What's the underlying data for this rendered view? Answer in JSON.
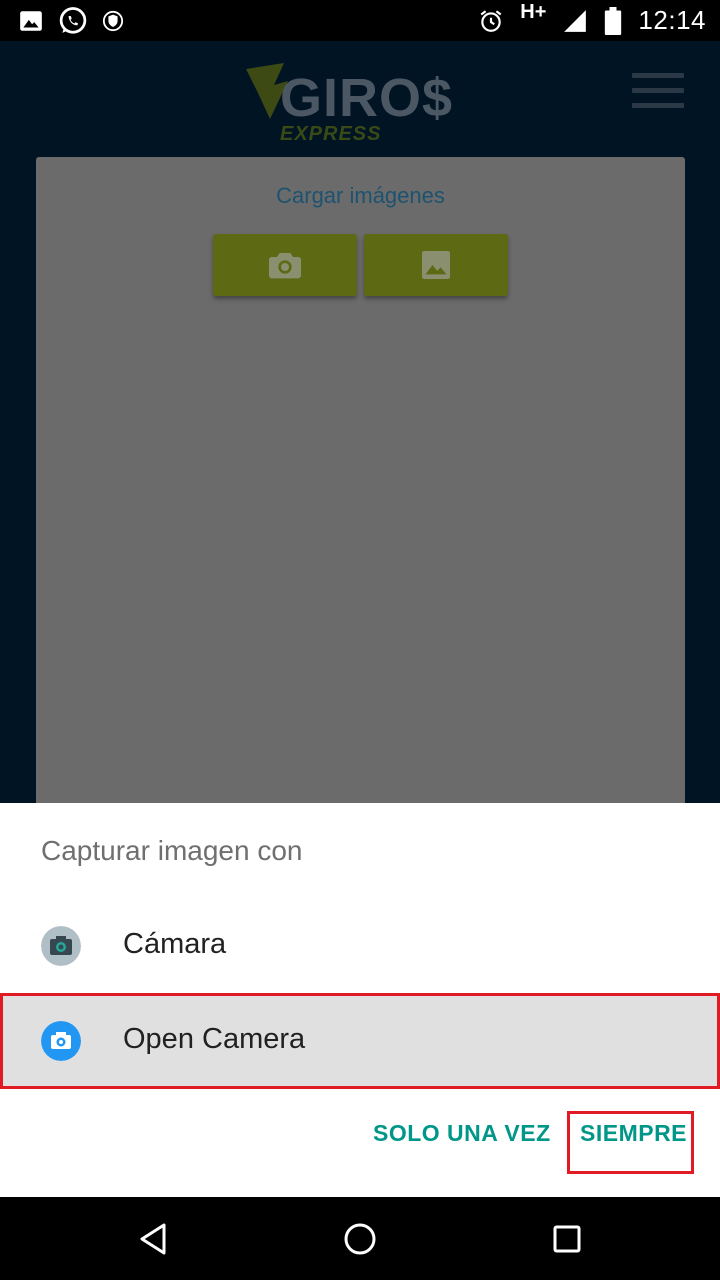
{
  "status_bar": {
    "time": "12:14",
    "network": "H+"
  },
  "app": {
    "logo_main": "GIRO$",
    "logo_sub": "EXPRESS",
    "card_title": "Cargar imágenes",
    "buttons": [
      {
        "icon": "camera-icon"
      },
      {
        "icon": "image-icon"
      }
    ]
  },
  "sheet": {
    "title": "Capturar imagen con",
    "apps": [
      {
        "label": "Cámara",
        "icon": "camera-app-icon"
      },
      {
        "label": "Open Camera",
        "icon": "open-camera-icon"
      }
    ],
    "once_label": "SOLO UNA VEZ",
    "always_label": "SIEMPRE"
  },
  "colors": {
    "accent": "#009688",
    "highlight": "#e01b24",
    "upload_button": "#5e6a13"
  }
}
